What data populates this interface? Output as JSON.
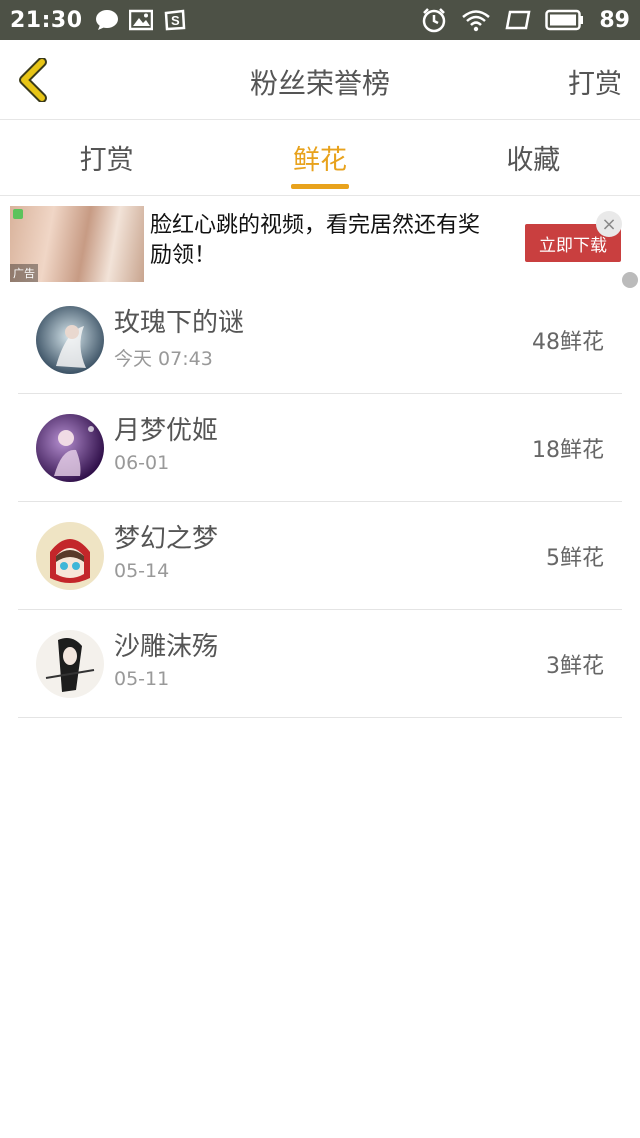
{
  "status_bar": {
    "time": "21:30",
    "icons_left": [
      "chat-icon",
      "image-icon",
      "s-icon"
    ],
    "icons_right": [
      "alarm-icon",
      "wifi-icon",
      "window-icon",
      "battery-icon"
    ],
    "battery": "89"
  },
  "nav": {
    "title": "粉丝荣誉榜",
    "right_action": "打赏",
    "back_icon": "chevron-left-icon"
  },
  "tabs": [
    {
      "label": "打赏",
      "active": false
    },
    {
      "label": "鲜花",
      "active": true
    },
    {
      "label": "收藏",
      "active": false
    }
  ],
  "ad": {
    "badge": "广告",
    "text": "脸红心跳的视频，看完居然还有奖励领！",
    "cta": "立即下载"
  },
  "fans": [
    {
      "name": "玫瑰下的谜",
      "date": "今天 07:43",
      "flowers": "48鲜花"
    },
    {
      "name": "月梦优姬",
      "date": "06-01",
      "flowers": "18鲜花"
    },
    {
      "name": "梦幻之梦",
      "date": "05-14",
      "flowers": "5鲜花"
    },
    {
      "name": "沙雕沫殇",
      "date": "05-11",
      "flowers": "3鲜花"
    }
  ],
  "colors": {
    "accent": "#e8a21c",
    "status_bar_bg": "#4d5146",
    "back_arrow": "#e8c516",
    "ad_button": "#c93f3f"
  }
}
